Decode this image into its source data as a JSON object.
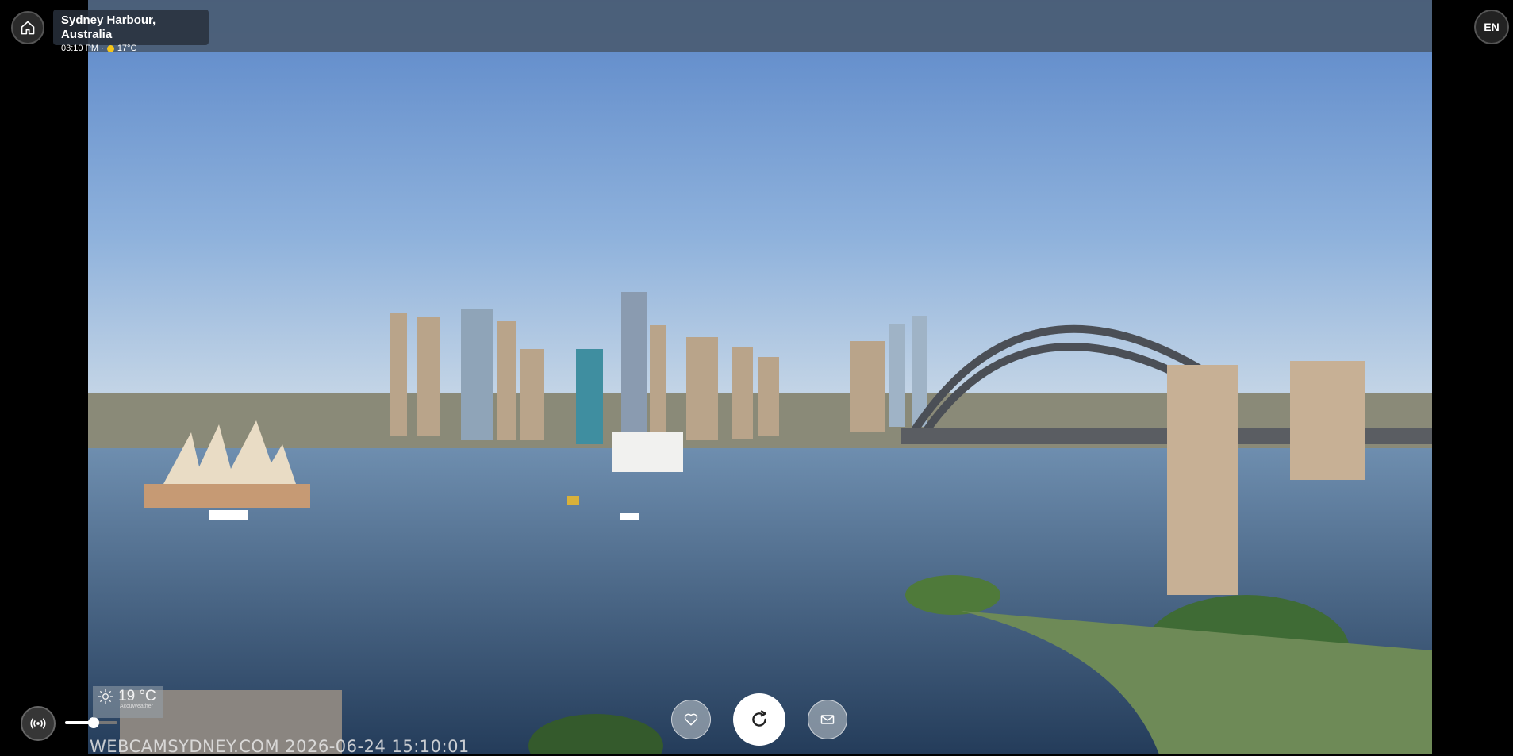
{
  "location": {
    "title": "Sydney Harbour, Australia",
    "time": "03:10 PM ·",
    "temperature": "17°C"
  },
  "language_button": "EN",
  "weather_overlay": {
    "temperature": "19 °C",
    "provider": "AccuWeather"
  },
  "watermark": "WEBCAMSYDNEY.COM 2026-06-24 15:10:01",
  "volume": {
    "level": 0.55
  },
  "icons": {
    "home": "home-icon",
    "live": "live-broadcast-icon",
    "favorite": "heart-icon",
    "refresh": "refresh-icon",
    "share": "mail-icon",
    "weather": "sun-icon"
  }
}
